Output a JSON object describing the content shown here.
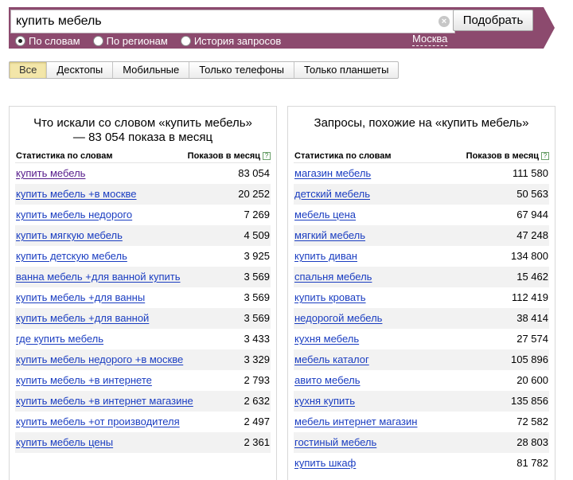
{
  "search": {
    "value": "купить мебель",
    "clear_icon": "×",
    "submit_label": "Подобрать"
  },
  "modes": [
    {
      "label": "По словам",
      "checked": true
    },
    {
      "label": "По регионам",
      "checked": false
    },
    {
      "label": "История запросов",
      "checked": false
    }
  ],
  "region": "Москва",
  "device_tabs": [
    "Все",
    "Десктопы",
    "Мобильные",
    "Только телефоны",
    "Только планшеты"
  ],
  "active_tab": 0,
  "left": {
    "title": "Что искали со словом «купить мебель» — 83 054 показа в месяц",
    "col_keyword": "Статистика по словам",
    "col_count": "Показов в месяц",
    "help": "?",
    "rows": [
      {
        "kw": "купить мебель",
        "n": "83 054",
        "visited": true
      },
      {
        "kw": "купить мебель +в москве",
        "n": "20 252"
      },
      {
        "kw": "купить мебель недорого",
        "n": "7 269"
      },
      {
        "kw": "купить мягкую мебель",
        "n": "4 509"
      },
      {
        "kw": "купить детскую мебель",
        "n": "3 925"
      },
      {
        "kw": "ванна мебель +для ванной купить",
        "n": "3 569"
      },
      {
        "kw": "купить мебель +для ванны",
        "n": "3 569"
      },
      {
        "kw": "купить мебель +для ванной",
        "n": "3 569"
      },
      {
        "kw": "где купить мебель",
        "n": "3 433"
      },
      {
        "kw": "купить мебель недорого +в москве",
        "n": "3 329"
      },
      {
        "kw": "купить мебель +в интернете",
        "n": "2 793"
      },
      {
        "kw": "купить мебель +в интернет магазине",
        "n": "2 632"
      },
      {
        "kw": "купить мебель +от производителя",
        "n": "2 497"
      },
      {
        "kw": "купить мебель цены",
        "n": "2 361"
      }
    ]
  },
  "right": {
    "title": "Запросы, похожие на «купить мебель»",
    "col_keyword": "Статистика по словам",
    "col_count": "Показов в месяц",
    "help": "?",
    "rows": [
      {
        "kw": "магазин мебель",
        "n": "111 580"
      },
      {
        "kw": "детский мебель",
        "n": "50 563"
      },
      {
        "kw": "мебель цена",
        "n": "67 944"
      },
      {
        "kw": "мягкий мебель",
        "n": "47 248"
      },
      {
        "kw": "купить диван",
        "n": "134 800"
      },
      {
        "kw": "спальня мебель",
        "n": "15 462"
      },
      {
        "kw": "купить кровать",
        "n": "112 419"
      },
      {
        "kw": "недорогой мебель",
        "n": "38 414"
      },
      {
        "kw": "кухня мебель",
        "n": "27 574"
      },
      {
        "kw": "мебель каталог",
        "n": "105 896"
      },
      {
        "kw": "авито мебель",
        "n": "20 600"
      },
      {
        "kw": "кухня купить",
        "n": "135 856"
      },
      {
        "kw": "мебель интернет магазин",
        "n": "72 582"
      },
      {
        "kw": "гостиный мебель",
        "n": "28 803"
      },
      {
        "kw": "купить шкаф",
        "n": "81 782"
      }
    ]
  },
  "colors": {
    "band": "#8c4a6e",
    "link": "#1a3dc1",
    "visited": "#551a8b",
    "active_tab": "#f3e6a9"
  }
}
